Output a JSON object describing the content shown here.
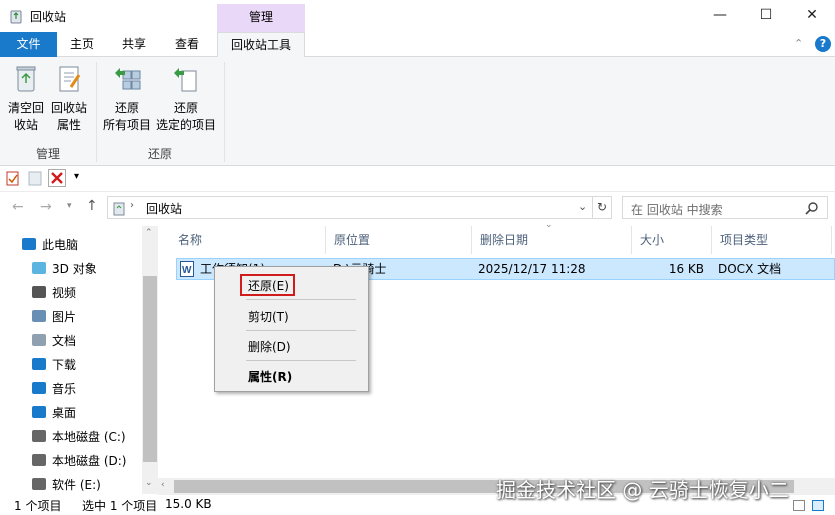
{
  "window": {
    "title": "回收站",
    "context_tab": "管理"
  },
  "ribbon_tabs": {
    "file": "文件",
    "home": "主页",
    "share": "共享",
    "view": "查看",
    "tools": "回收站工具"
  },
  "ribbon": {
    "empty_line1": "清空回",
    "empty_line2": "收站",
    "props_line1": "回收站",
    "props_line2": "属性",
    "group_manage": "管理",
    "restore_all_line1": "还原",
    "restore_all_line2": "所有项目",
    "restore_sel_line1": "还原",
    "restore_sel_line2": "选定的项目",
    "group_restore": "还原"
  },
  "address": {
    "path": "回收站",
    "search_placeholder": "在 回收站 中搜索"
  },
  "nav": [
    {
      "label": "此电脑",
      "icon": "pc-icon"
    },
    {
      "label": "3D 对象",
      "icon": "cube-icon"
    },
    {
      "label": "视频",
      "icon": "video-icon"
    },
    {
      "label": "图片",
      "icon": "picture-icon"
    },
    {
      "label": "文档",
      "icon": "document-icon"
    },
    {
      "label": "下载",
      "icon": "download-icon"
    },
    {
      "label": "音乐",
      "icon": "music-icon"
    },
    {
      "label": "桌面",
      "icon": "desktop-icon"
    },
    {
      "label": "本地磁盘 (C:)",
      "icon": "drive-icon"
    },
    {
      "label": "本地磁盘 (D:)",
      "icon": "drive-icon"
    },
    {
      "label": "软件 (E:)",
      "icon": "drive-icon"
    }
  ],
  "columns": {
    "name": "名称",
    "orig": "原位置",
    "deleted": "删除日期",
    "size": "大小",
    "type": "项目类型"
  },
  "file": {
    "name": "工作须知(1)",
    "orig": "D:\\云骑士",
    "deleted": "2025/12/17 11:28",
    "size": "16 KB",
    "type": "DOCX 文档"
  },
  "context_menu": {
    "restore": "还原(E)",
    "cut": "剪切(T)",
    "delete": "删除(D)",
    "properties": "属性(R)"
  },
  "status": {
    "count": "1 个项目",
    "selected": "选中 1 个项目",
    "size": "15.0 KB"
  },
  "watermark": "掘金技术社区 @ 云骑士恢复小二",
  "colors": {
    "accent": "#1979ca",
    "selection": "#cce8ff",
    "highlight_box": "#d01c1c",
    "context_tab": "#e9d8f7"
  }
}
